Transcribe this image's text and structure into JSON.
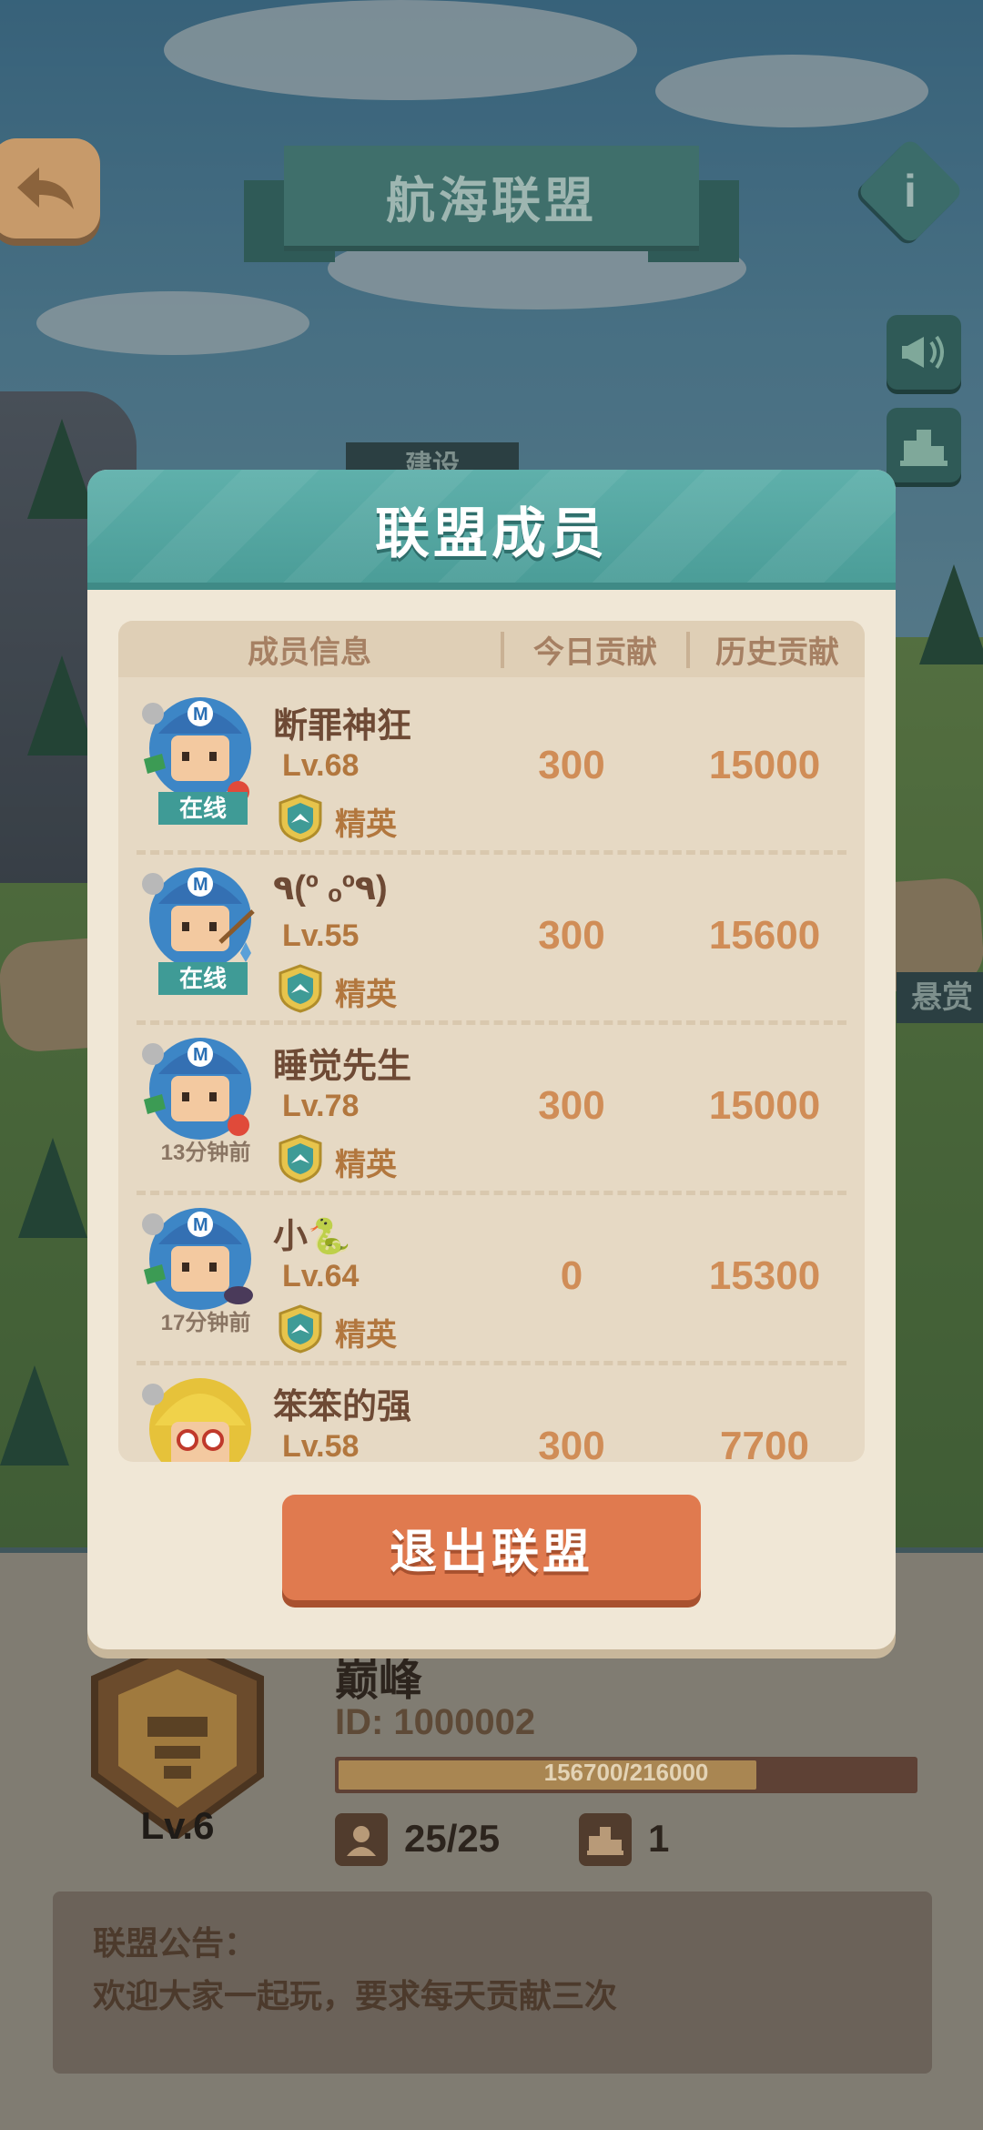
{
  "header": {
    "title": "航海联盟",
    "info_icon": "i"
  },
  "scene_tags": {
    "construct": "建设",
    "bounty": "悬赏"
  },
  "modal": {
    "title": "联盟成员",
    "columns": [
      "成员信息",
      "今日贡献",
      "历史贡献"
    ],
    "members": [
      {
        "name": "断罪神狂",
        "level": "Lv.68",
        "rank": "精英",
        "status": "在线",
        "online": true,
        "today": "300",
        "history": "15000",
        "avatar": "blue-cap-avatar"
      },
      {
        "name": "٩(º ₒº٩)",
        "level": "Lv.55",
        "rank": "精英",
        "status": "在线",
        "online": true,
        "today": "300",
        "history": "15600",
        "avatar": "blue-cap-avatar"
      },
      {
        "name": "睡觉先生",
        "level": "Lv.78",
        "rank": "精英",
        "status": "13分钟前",
        "online": false,
        "today": "300",
        "history": "15000",
        "avatar": "blue-cap-avatar"
      },
      {
        "name": "小🐍",
        "level": "Lv.64",
        "rank": "精英",
        "status": "17分钟前",
        "online": false,
        "today": "0",
        "history": "15300",
        "avatar": "blue-cap-avatar"
      },
      {
        "name": "笨笨的强",
        "level": "Lv.58",
        "rank": "",
        "status": "",
        "online": false,
        "today": "300",
        "history": "7700",
        "avatar": "blonde-glasses-avatar"
      }
    ],
    "quit_button": "退出联盟"
  },
  "alliance": {
    "level": "Lv.6",
    "name": "巅峰",
    "id": "ID: 1000002",
    "xp_text": "156700/216000",
    "xp_fraction": 0.7255,
    "members_count": "25/25",
    "rank_value": "1"
  },
  "notice": {
    "title": "联盟公告：",
    "text": "欢迎大家一起玩，要求每天贡献三次"
  },
  "colors": {
    "modal_header": "#4b9d98",
    "accent_orange": "#e07a4f",
    "value_orange": "#d08d57",
    "online_badge": "#3f9b96"
  }
}
